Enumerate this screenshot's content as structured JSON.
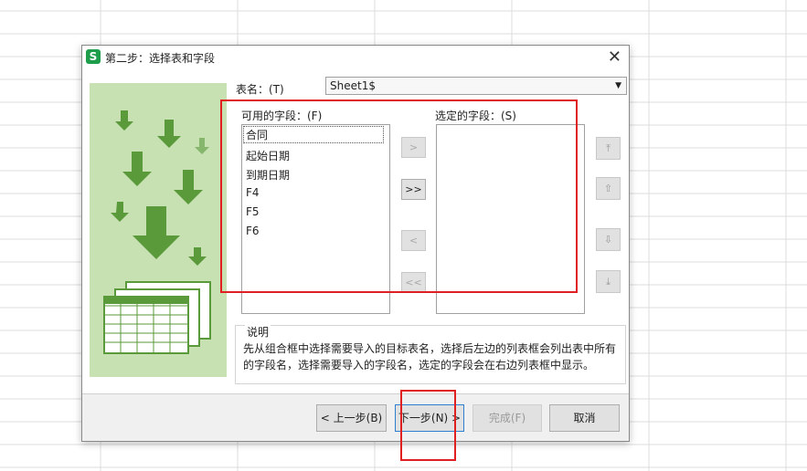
{
  "dialog": {
    "title": "第二步：选择表和字段",
    "app_icon_letter": "S",
    "close_symbol": "✕"
  },
  "table_select": {
    "label": "表名：(T)",
    "value": "Sheet1$",
    "arrow": "▼"
  },
  "available": {
    "label": "可用的字段：(F)",
    "items": [
      "合同",
      "起始日期",
      "到期日期",
      "F4",
      "F5",
      "F6"
    ]
  },
  "selected": {
    "label": "选定的字段：(S)",
    "items": []
  },
  "move_buttons": {
    "add_one": ">",
    "add_all": ">>",
    "remove_one": "<",
    "remove_all": "<<"
  },
  "order_buttons": {
    "top": "⤒",
    "up": "⇧",
    "down": "⇩",
    "bottom": "⤓"
  },
  "description": {
    "title": "说明",
    "text": "先从组合框中选择需要导入的目标表名，选择后左边的列表框会列出表中所有的字段名，选择需要导入的字段名，选定的字段会在右边列表框中显示。"
  },
  "footer": {
    "back": "< 上一步(B)",
    "next": "下一步(N) >",
    "finish": "完成(F)",
    "cancel": "取消"
  },
  "colors": {
    "illustration_bg": "#c7e1b3",
    "arrow_green": "#5a9a3a",
    "highlight_red": "#e02020"
  }
}
